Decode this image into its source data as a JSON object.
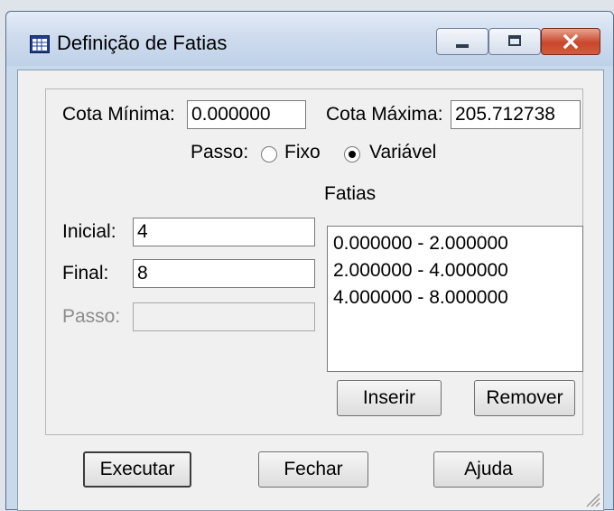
{
  "window": {
    "title": "Definição de Fatias"
  },
  "cota": {
    "min_label": "Cota Mínima:",
    "min_value": "0.000000",
    "max_label": "Cota Máxima:",
    "max_value": "205.712738"
  },
  "passo": {
    "label": "Passo:",
    "options": [
      "Fixo",
      "Variável"
    ],
    "selected": "Variável"
  },
  "fatias": {
    "label": "Fatias",
    "items": [
      "0.000000 - 2.000000",
      "2.000000 - 4.000000",
      "4.000000 - 8.000000"
    ]
  },
  "fields": {
    "inicial_label": "Inicial:",
    "inicial_value": "4",
    "final_label": "Final:",
    "final_value": "8",
    "passo_label": "Passo:",
    "passo_value": ""
  },
  "buttons": {
    "inserir": "Inserir",
    "remover": "Remover",
    "executar": "Executar",
    "fechar": "Fechar",
    "ajuda": "Ajuda"
  }
}
